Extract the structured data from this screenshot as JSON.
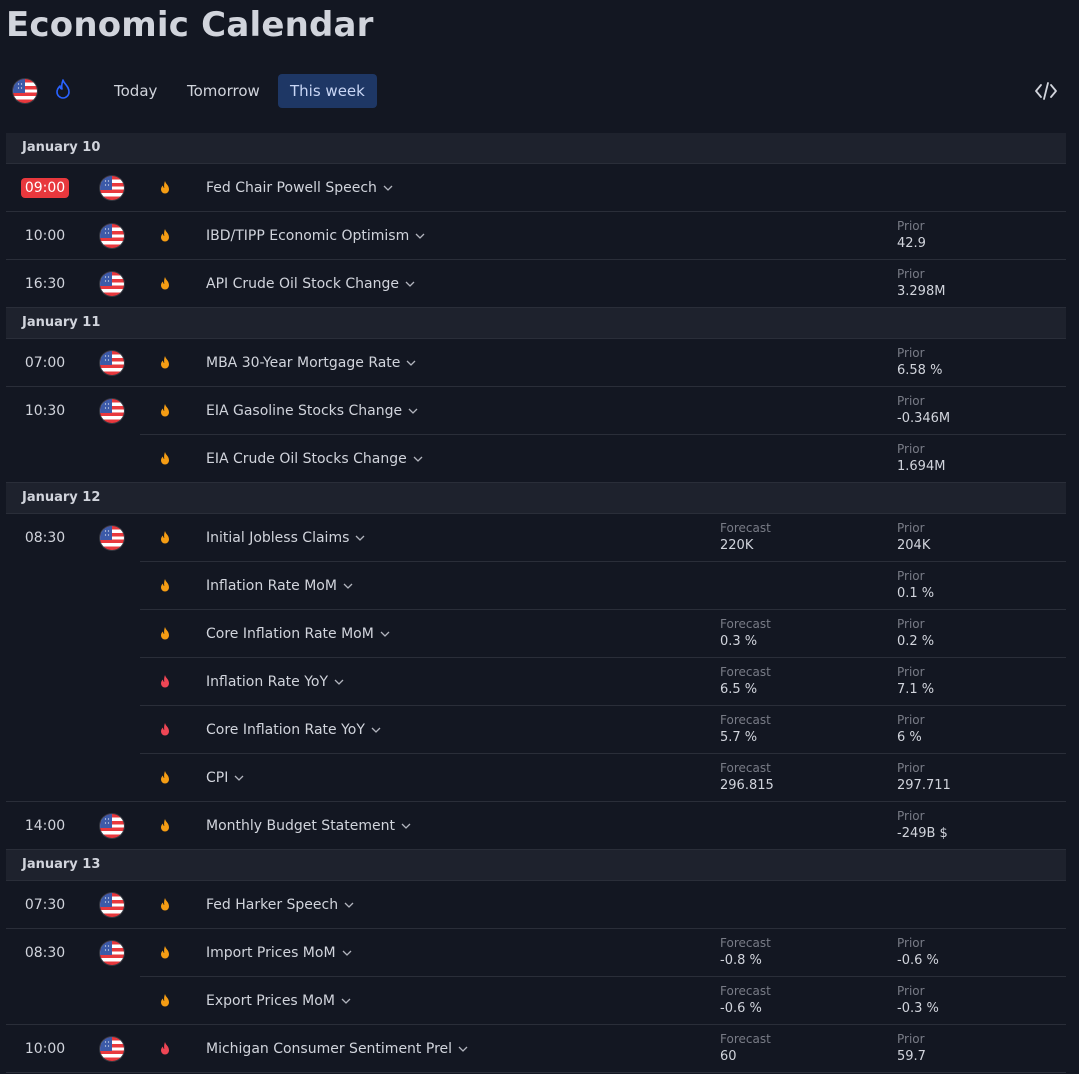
{
  "page_title": "Economic Calendar",
  "toolbar": {
    "country_icon": "us-flag-icon",
    "importance_icon": "fire-filter-icon",
    "tabs": [
      "Today",
      "Tomorrow",
      "This week"
    ],
    "active_tab": "This week",
    "embed_icon": "code-embed-icon"
  },
  "labels": {
    "forecast": "Forecast",
    "prior": "Prior"
  },
  "colors": {
    "background": "#131722",
    "date_row": "#1e222d",
    "active_tab": "#1e3765",
    "live_time": "#e8383d",
    "importance_medium": "#f59d14",
    "importance_high": "#ef4655"
  },
  "days": [
    {
      "date": "January 10",
      "groups": [
        {
          "time": "09:00",
          "live": true,
          "events": [
            {
              "name": "Fed Chair Powell Speech",
              "importance": "medium",
              "forecast": "",
              "prior": ""
            }
          ]
        },
        {
          "time": "10:00",
          "events": [
            {
              "name": "IBD/TIPP Economic Optimism",
              "importance": "medium",
              "forecast": "",
              "prior": "42.9"
            }
          ]
        },
        {
          "time": "16:30",
          "events": [
            {
              "name": "API Crude Oil Stock Change",
              "importance": "medium",
              "forecast": "",
              "prior": "3.298M"
            }
          ]
        }
      ]
    },
    {
      "date": "January 11",
      "groups": [
        {
          "time": "07:00",
          "events": [
            {
              "name": "MBA 30-Year Mortgage Rate",
              "importance": "medium",
              "forecast": "",
              "prior": "6.58 %"
            }
          ]
        },
        {
          "time": "10:30",
          "events": [
            {
              "name": "EIA Gasoline Stocks Change",
              "importance": "medium",
              "forecast": "",
              "prior": "-0.346M"
            },
            {
              "name": "EIA Crude Oil Stocks Change",
              "importance": "medium",
              "forecast": "",
              "prior": "1.694M"
            }
          ]
        }
      ]
    },
    {
      "date": "January 12",
      "groups": [
        {
          "time": "08:30",
          "events": [
            {
              "name": "Initial Jobless Claims",
              "importance": "medium",
              "forecast": "220K",
              "prior": "204K"
            },
            {
              "name": "Inflation Rate MoM",
              "importance": "medium",
              "forecast": "",
              "prior": "0.1 %"
            },
            {
              "name": "Core Inflation Rate MoM",
              "importance": "medium",
              "forecast": "0.3 %",
              "prior": "0.2 %"
            },
            {
              "name": "Inflation Rate YoY",
              "importance": "high",
              "forecast": "6.5 %",
              "prior": "7.1 %"
            },
            {
              "name": "Core Inflation Rate YoY",
              "importance": "high",
              "forecast": "5.7 %",
              "prior": "6 %"
            },
            {
              "name": "CPI",
              "importance": "medium",
              "forecast": "296.815",
              "prior": "297.711"
            }
          ]
        },
        {
          "time": "14:00",
          "events": [
            {
              "name": "Monthly Budget Statement",
              "importance": "medium",
              "forecast": "",
              "prior": "-249B $"
            }
          ]
        }
      ]
    },
    {
      "date": "January 13",
      "groups": [
        {
          "time": "07:30",
          "events": [
            {
              "name": "Fed Harker Speech",
              "importance": "medium",
              "forecast": "",
              "prior": ""
            }
          ]
        },
        {
          "time": "08:30",
          "events": [
            {
              "name": "Import Prices MoM",
              "importance": "medium",
              "forecast": "-0.8 %",
              "prior": "-0.6 %"
            },
            {
              "name": "Export Prices MoM",
              "importance": "medium",
              "forecast": "-0.6 %",
              "prior": "-0.3 %"
            }
          ]
        },
        {
          "time": "10:00",
          "events": [
            {
              "name": "Michigan Consumer Sentiment Prel",
              "importance": "high",
              "forecast": "60",
              "prior": "59.7"
            }
          ]
        }
      ]
    }
  ]
}
